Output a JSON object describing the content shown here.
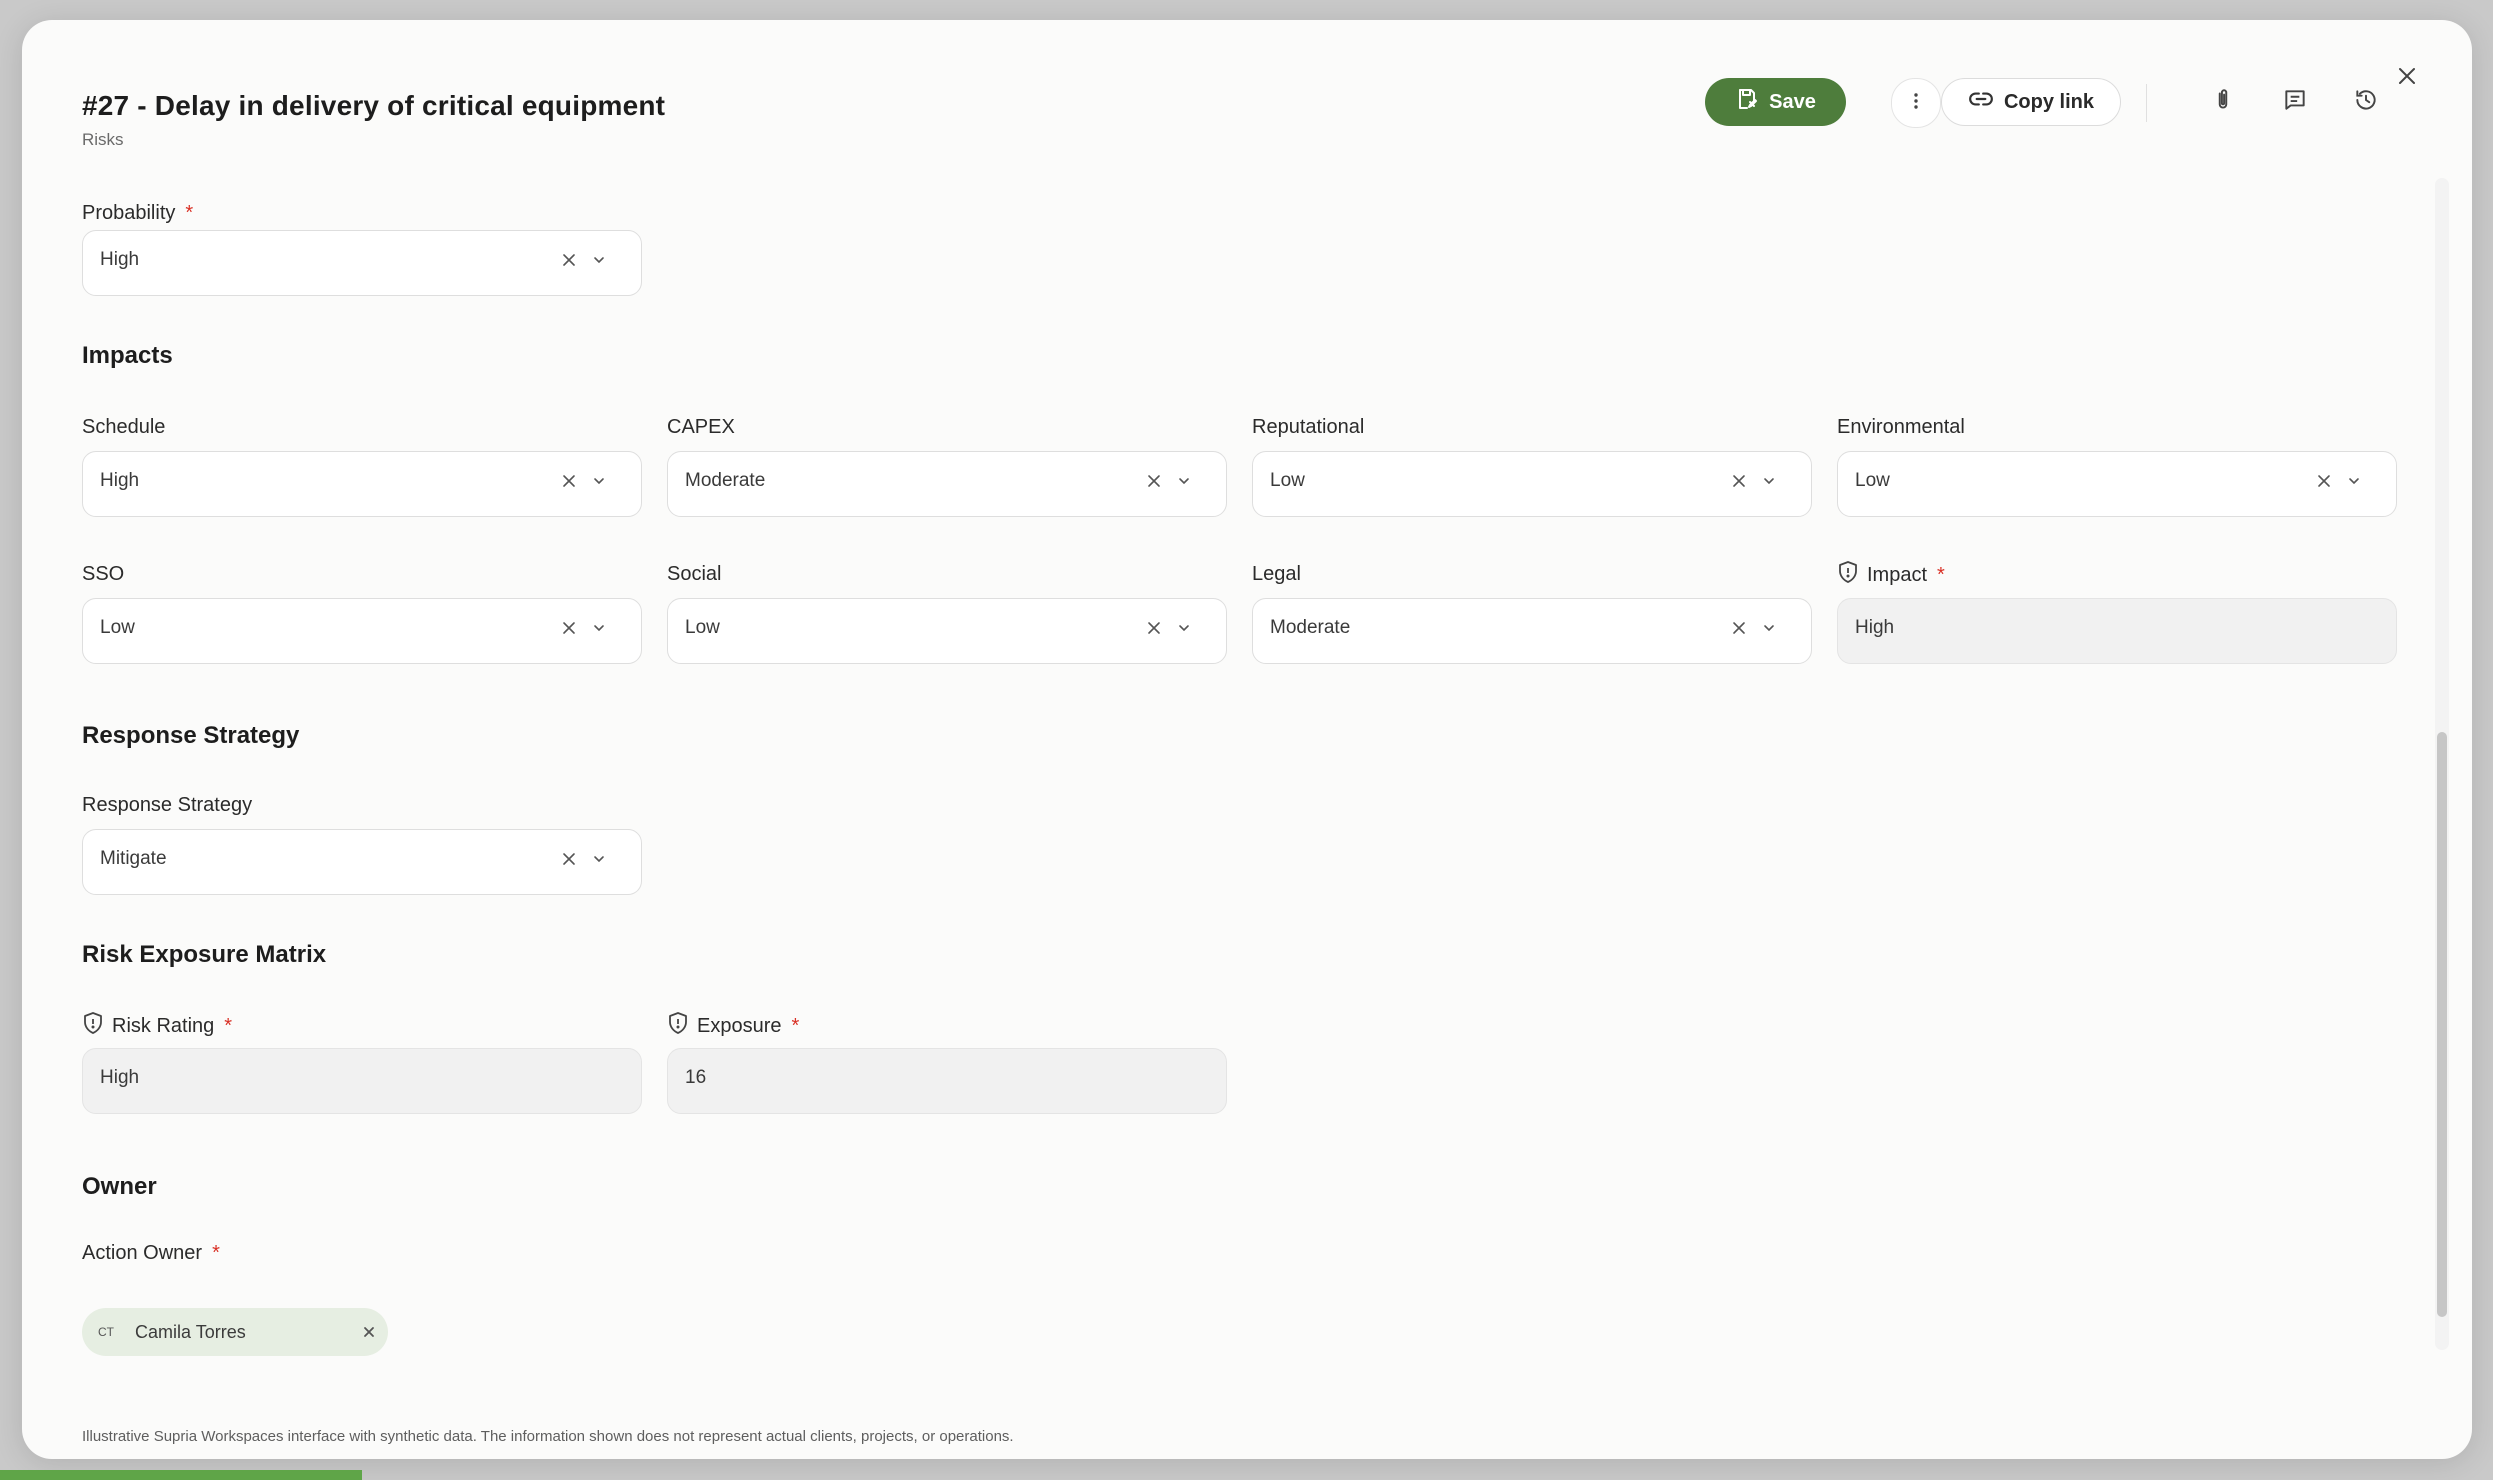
{
  "header": {
    "title": "#27 - Delay in delivery of critical equipment",
    "subtitle": "Risks",
    "save_label": "Save",
    "copy_link_label": "Copy link",
    "icons": [
      "save-icon",
      "more-vertical-icon",
      "link-icon",
      "paperclip-icon",
      "comment-icon",
      "history-icon",
      "close-icon"
    ]
  },
  "probability": {
    "label": "Probability",
    "value": "High",
    "required": "*"
  },
  "impacts": {
    "title": "Impacts",
    "schedule": {
      "label": "Schedule",
      "value": "High"
    },
    "capex": {
      "label": "CAPEX",
      "value": "Moderate"
    },
    "reputational": {
      "label": "Reputational",
      "value": "Low"
    },
    "environmental": {
      "label": "Environmental",
      "value": "Low"
    },
    "sso": {
      "label": "SSO",
      "value": "Low"
    },
    "social": {
      "label": "Social",
      "value": "Low"
    },
    "legal": {
      "label": "Legal",
      "value": "Moderate"
    },
    "impact": {
      "label": "Impact",
      "value": "High",
      "required": "*"
    }
  },
  "response": {
    "title": "Response Strategy",
    "field": {
      "label": "Response Strategy",
      "value": "Mitigate"
    }
  },
  "matrix": {
    "title": "Risk Exposure Matrix",
    "risk_rating": {
      "label": "Risk Rating",
      "value": "High",
      "required": "*"
    },
    "exposure": {
      "label": "Exposure",
      "value": "16",
      "required": "*"
    }
  },
  "owner": {
    "title": "Owner",
    "action_owner": {
      "label": "Action Owner",
      "required": "*",
      "initials": "CT",
      "name": "Camila Torres"
    }
  },
  "footer": "Illustrative Supria Workspaces interface with synthetic data. The information shown does not represent actual clients, projects, or operations.",
  "colors": {
    "primary": "#4e7d3c",
    "required": "#d93025",
    "chip_bg": "#e6eee2",
    "accent_bar": "#5fa548"
  }
}
